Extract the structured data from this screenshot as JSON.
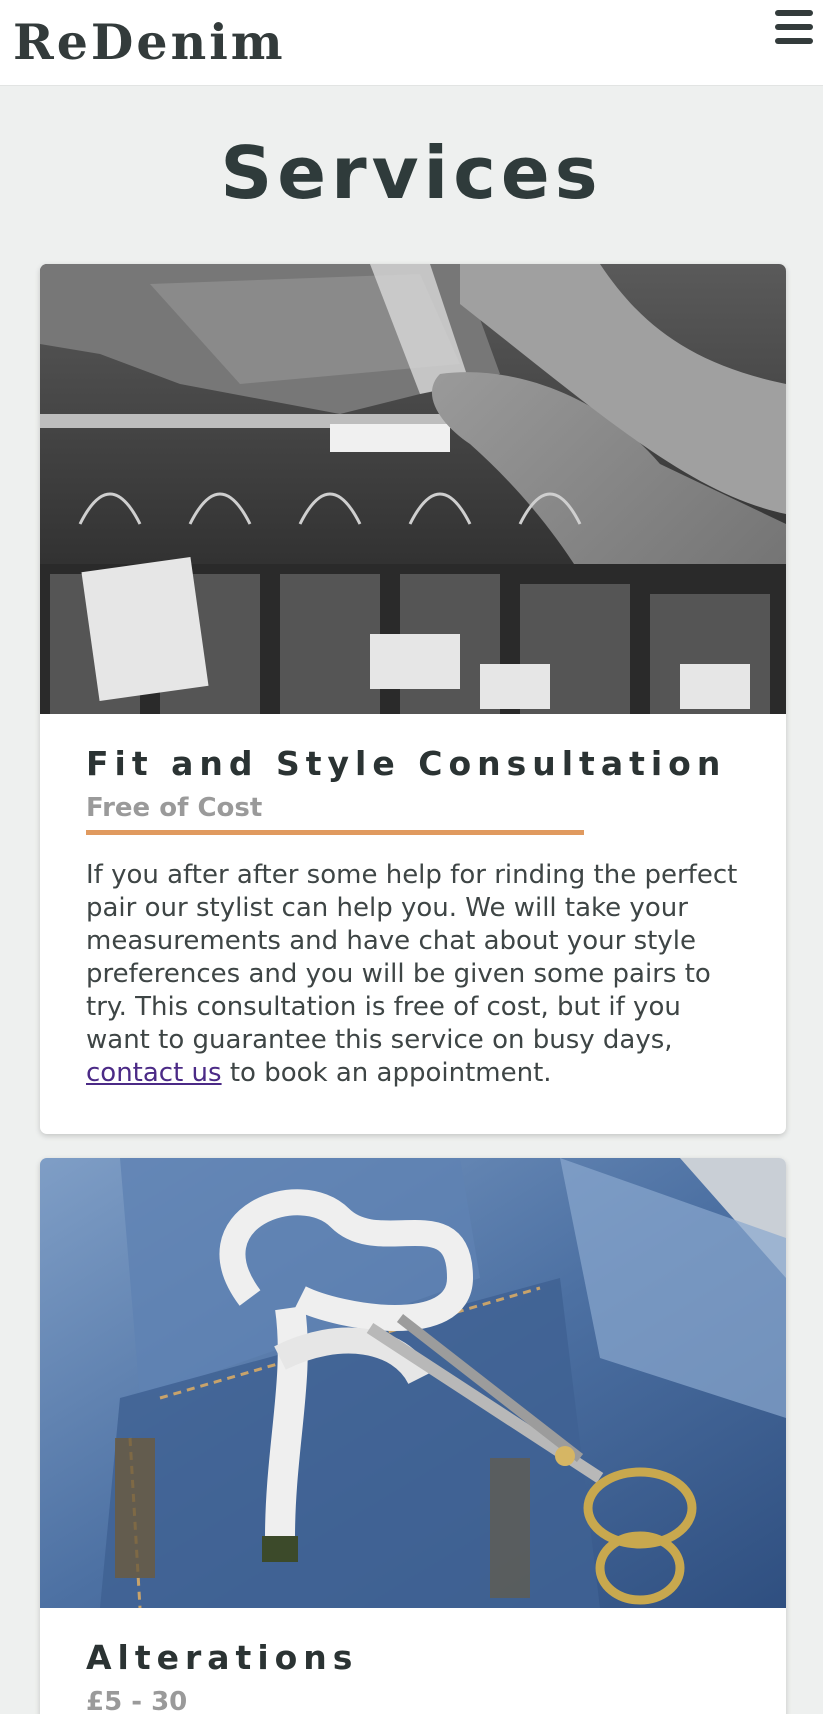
{
  "header": {
    "brand": "ReDenim",
    "menu_icon": "hamburger-menu-icon"
  },
  "page": {
    "title": "Services"
  },
  "services": [
    {
      "title": "Fit and Style Consultation",
      "price": "Free of Cost",
      "description_before_link": "If you after after some help for rinding the perfect pair our stylist can help you. We will take your measurements and have chat about your style preferences and you will be given some pairs to try. This consultation is free of cost, but if you want to guarantee this service on busy days, ",
      "link_text": "contact us",
      "description_after_link": " to book an appointment."
    },
    {
      "title": "Alterations",
      "price": "£5 - 30"
    }
  ],
  "colors": {
    "accent": "#e09a5f",
    "link": "#4b2a86",
    "background": "#eef0ef"
  }
}
